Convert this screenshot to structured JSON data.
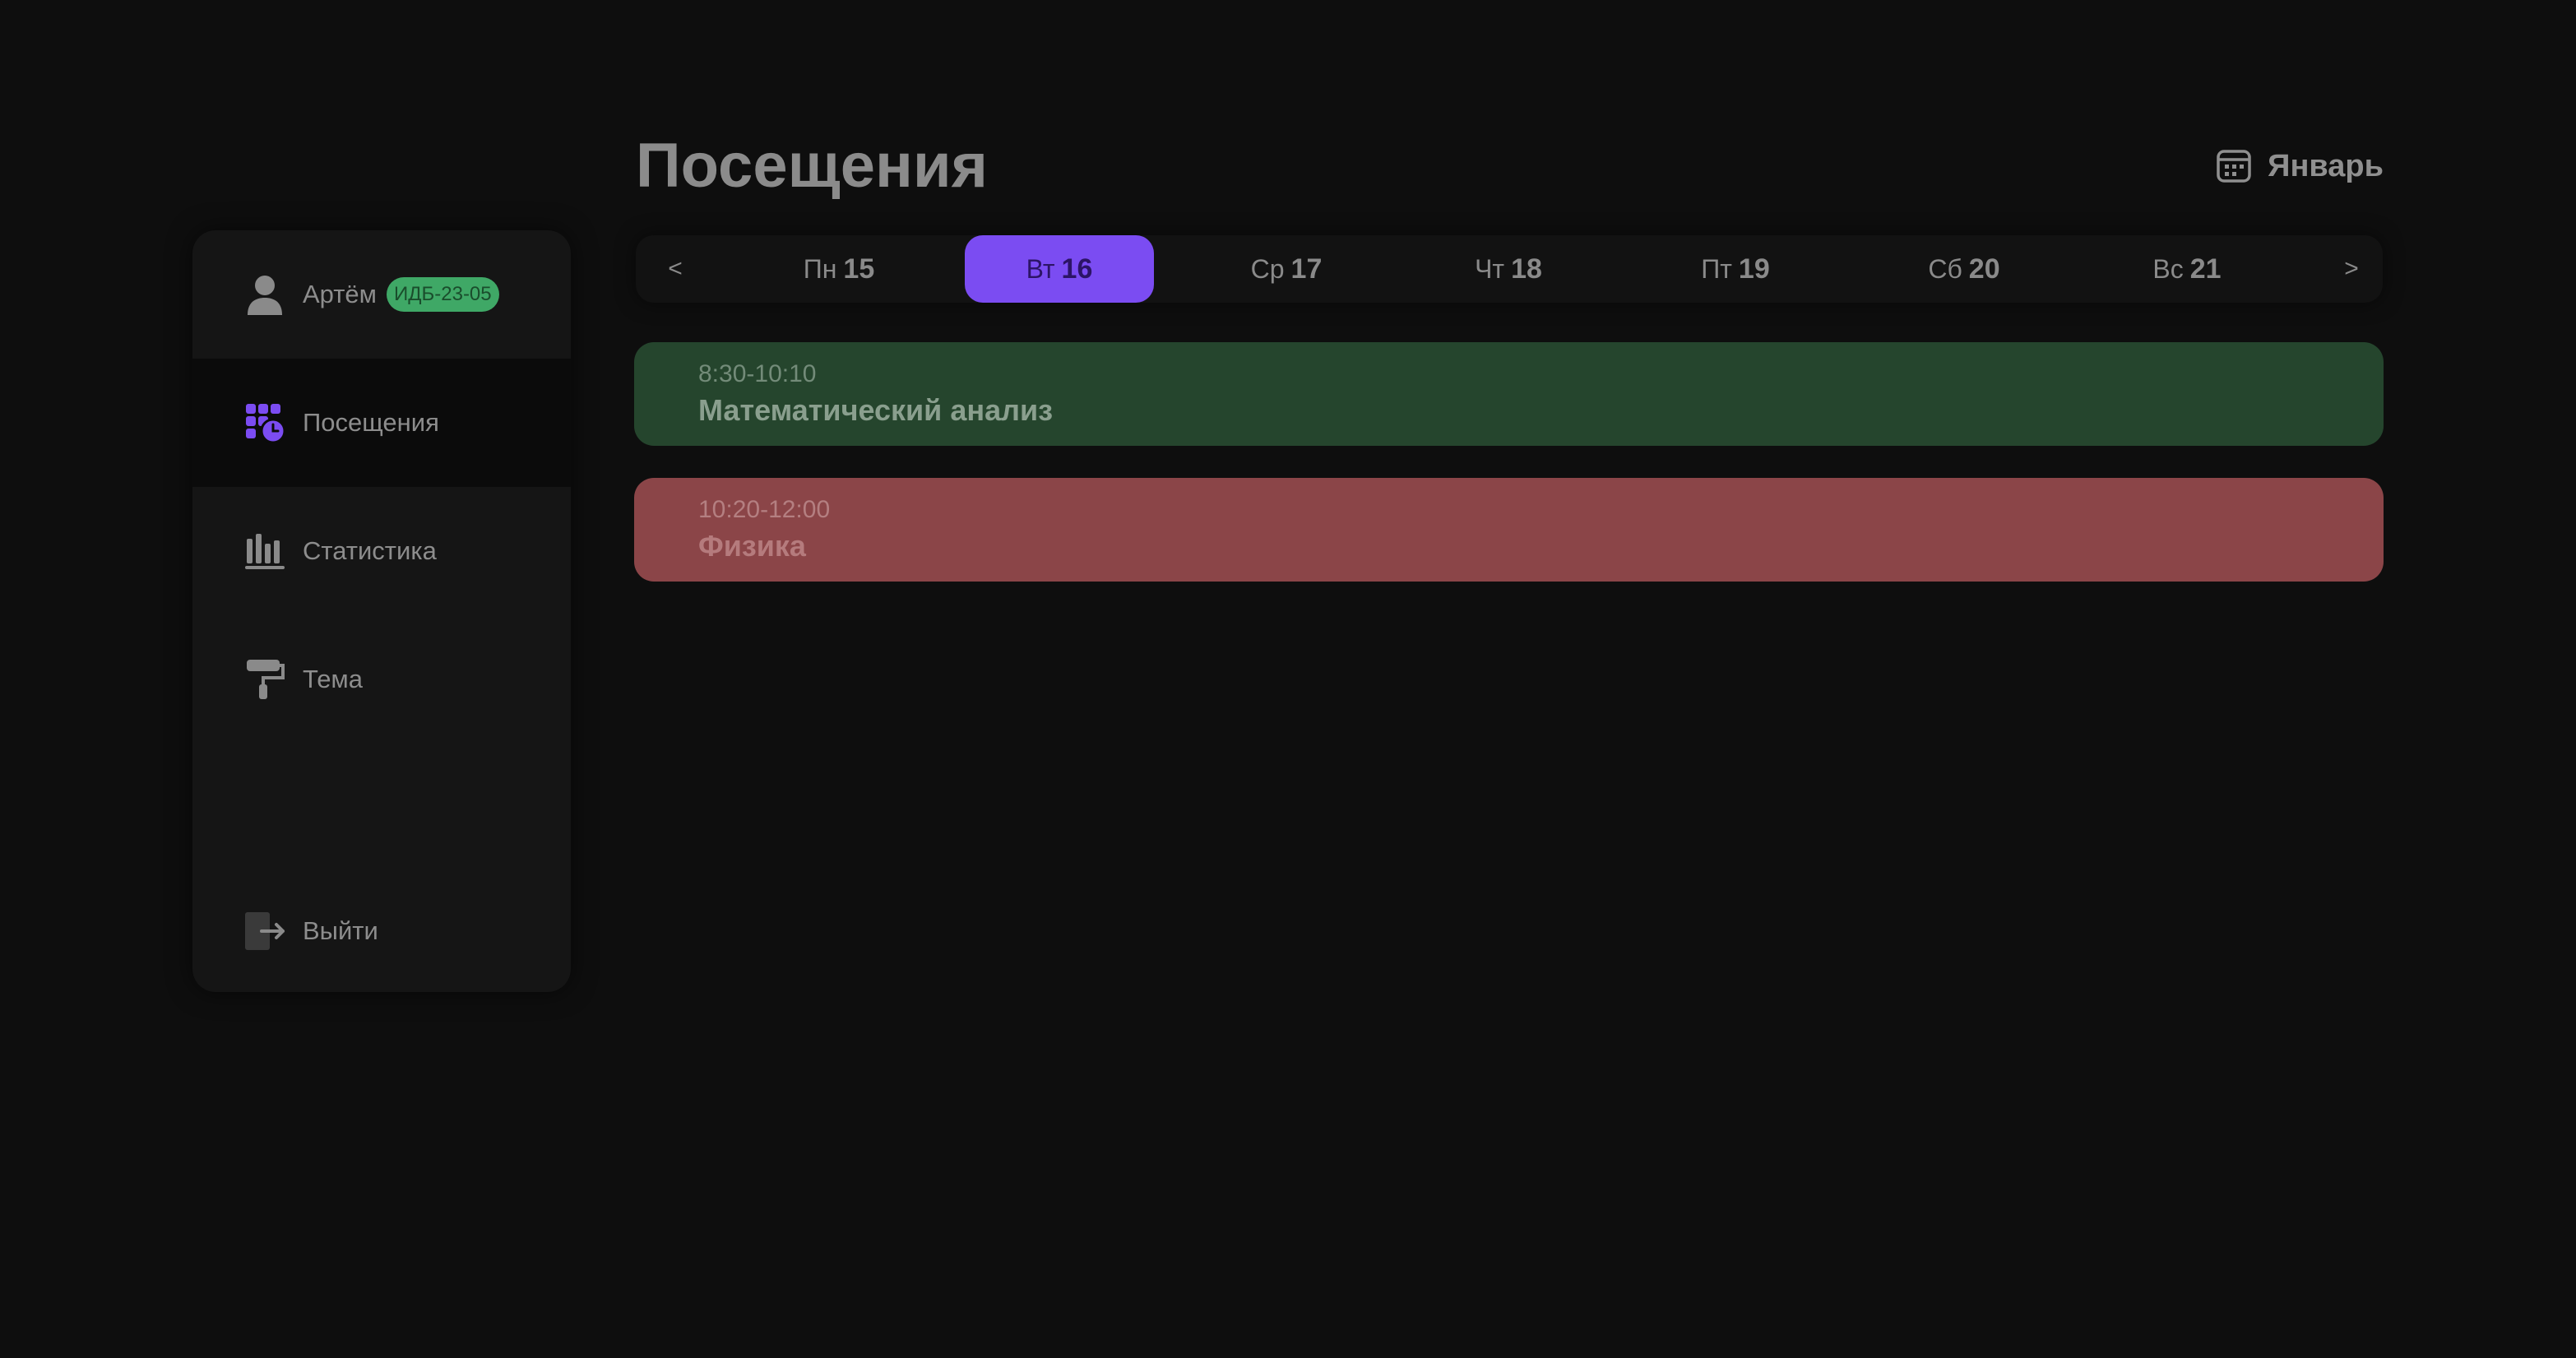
{
  "header": {
    "title": "Посещения",
    "month_label": "Январь",
    "month_icon": "calendar-icon"
  },
  "sidebar": {
    "user": {
      "name": "Артём",
      "group": "ИДБ-23-05",
      "icon": "user-icon"
    },
    "items": [
      {
        "label": "Посещения",
        "icon": "attendance-icon",
        "active": true
      },
      {
        "label": "Статистика",
        "icon": "bar-chart-icon",
        "active": false
      },
      {
        "label": "Тема",
        "icon": "paint-roller-icon",
        "active": false
      }
    ],
    "logout": {
      "label": "Выйти",
      "icon": "logout-icon"
    }
  },
  "week": {
    "prev": "<",
    "next": ">",
    "days": [
      {
        "name": "Пн",
        "num": "15",
        "selected": false
      },
      {
        "name": "Вт",
        "num": "16",
        "selected": true
      },
      {
        "name": "Ср",
        "num": "17",
        "selected": false
      },
      {
        "name": "Чт",
        "num": "18",
        "selected": false
      },
      {
        "name": "Пт",
        "num": "19",
        "selected": false
      },
      {
        "name": "Сб",
        "num": "20",
        "selected": false
      },
      {
        "name": "Вс",
        "num": "21",
        "selected": false
      }
    ]
  },
  "lessons": [
    {
      "time": "8:30-10:10",
      "name": "Математический анализ",
      "status": "present",
      "color": "#25452d"
    },
    {
      "time": "10:20-12:00",
      "name": "Физика",
      "status": "absent",
      "color": "#8b4548"
    }
  ],
  "colors": {
    "accent": "#7b4cf2",
    "background": "#0e0e0e",
    "badge": "#3fa866"
  }
}
